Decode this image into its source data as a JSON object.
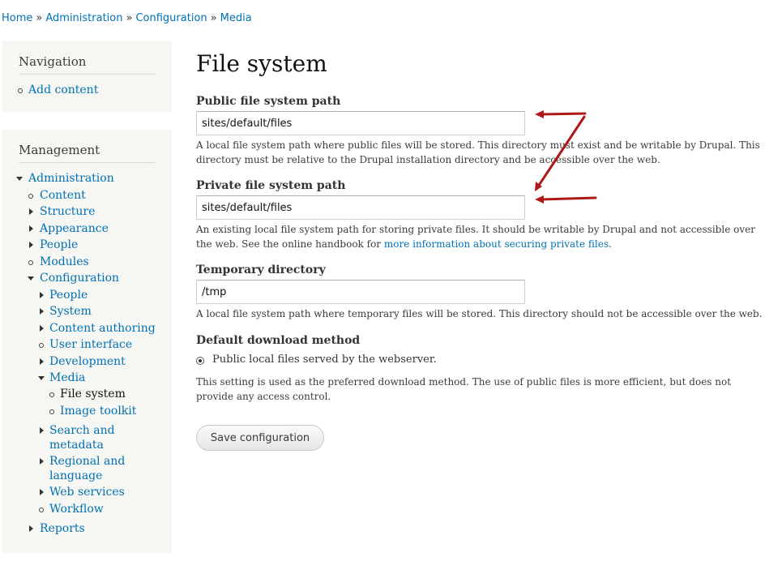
{
  "breadcrumb": {
    "items": [
      "Home",
      "Administration",
      "Configuration",
      "Media"
    ],
    "separator": "»"
  },
  "navigation": {
    "title": "Navigation",
    "items": [
      {
        "label": "Add content"
      }
    ]
  },
  "management": {
    "title": "Management",
    "items": [
      {
        "label": "Administration"
      },
      {
        "label": "Content"
      },
      {
        "label": "Structure"
      },
      {
        "label": "Appearance"
      },
      {
        "label": "People"
      },
      {
        "label": "Modules"
      },
      {
        "label": "Configuration"
      },
      {
        "label": "People"
      },
      {
        "label": "System"
      },
      {
        "label": "Content authoring"
      },
      {
        "label": "User interface"
      },
      {
        "label": "Development"
      },
      {
        "label": "Media"
      },
      {
        "label": "File system"
      },
      {
        "label": "Image toolkit"
      },
      {
        "label": "Search and"
      },
      {
        "label": "metadata"
      },
      {
        "label": "Regional and"
      },
      {
        "label": "language"
      },
      {
        "label": "Web services"
      },
      {
        "label": "Workflow"
      },
      {
        "label": "Reports"
      }
    ]
  },
  "page": {
    "title": "File system",
    "public_path": {
      "label": "Public file system path",
      "value": "sites/default/files",
      "description": "A local file system path where public files will be stored. This directory must exist and be writable by Drupal. This directory must be relative to the Drupal installation directory and be accessible over the web."
    },
    "private_path": {
      "label": "Private file system path",
      "value": "sites/default/files",
      "description_prefix": "An existing local file system path for storing private files. It should be writable by Drupal and not accessible over the web. See the online handbook for ",
      "description_link": "more information about securing private files",
      "description_suffix": "."
    },
    "temp_dir": {
      "label": "Temporary directory",
      "value": "/tmp",
      "description": "A local file system path where temporary files will be stored. This directory should not be accessible over the web."
    },
    "download_method": {
      "label": "Default download method",
      "option": "Public local files served by the webserver.",
      "description": "This setting is used as the preferred download method. The use of public files is more efficient, but does not provide any access control."
    },
    "save_label": "Save configuration"
  },
  "colors": {
    "link": "#0071b3",
    "sidebar_bg": "#f6f6f2",
    "annotation_arrow": "#b01818"
  }
}
